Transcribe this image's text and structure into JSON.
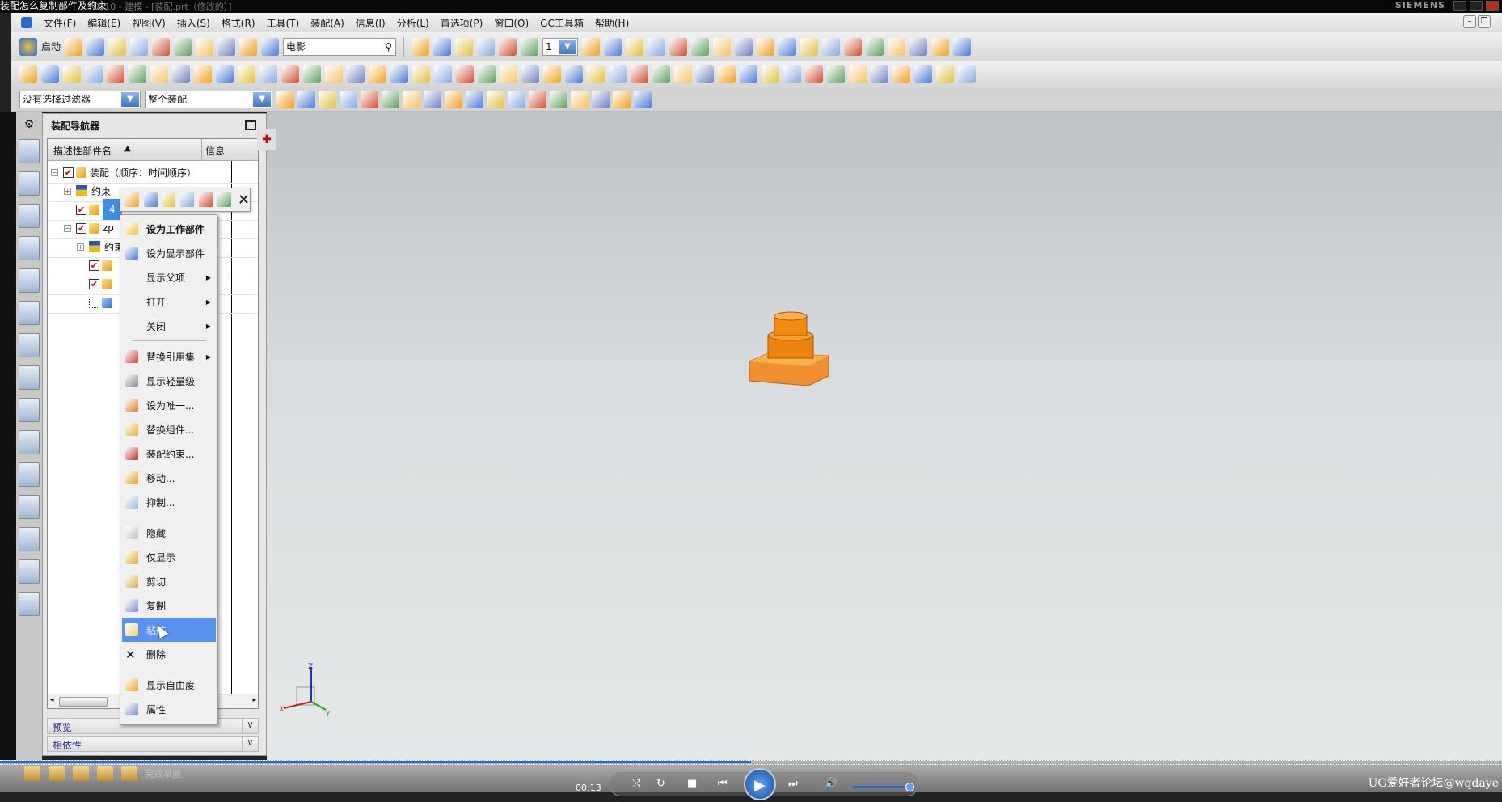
{
  "window": {
    "overlay_caption": "装配怎么复制部件及约束",
    "title": "NX 10 - 建模 - [装配.prt（修改的）]",
    "brand": "SIEMENS"
  },
  "menubar": [
    "文件(F)",
    "编辑(E)",
    "视图(V)",
    "插入(S)",
    "格式(R)",
    "工具(T)",
    "装配(A)",
    "信息(I)",
    "分析(L)",
    "首选项(P)",
    "窗口(O)",
    "GC工具箱",
    "帮助(H)"
  ],
  "toolbar": {
    "start_label": "启动",
    "search_value": "电影",
    "layer_value": "1",
    "selection_filter": "没有选择过滤器",
    "selection_scope": "整个装配",
    "row1_icons": [
      "new-icon",
      "open-icon",
      "save-icon",
      "cut-icon",
      "copy-icon",
      "paste-icon",
      "delete-icon",
      "undo-icon",
      "redo-icon",
      "repeat-command-icon"
    ],
    "row1b_icons": [
      "fit-icon",
      "zoom-icon",
      "render-style-icon",
      "orient-view-icon",
      "background-icon",
      "wcs-icon",
      "snap-view-icon",
      "layer-settings-icon",
      "move-to-layer-icon",
      "measure-icon",
      "analysis-icon",
      "curve-analysis-icon",
      "section-icon",
      "thickness-icon",
      "fastener-icon",
      "ring-icon",
      "hole-table-icon",
      "triangle-icon",
      "table-icon",
      "pmi-icon",
      "parts-list-icon",
      "note-icon",
      "gdt-icon",
      "fit-tolerance-icon"
    ],
    "row2_icons": [
      "sketch-icon",
      "datum-plane-icon",
      "extrude-icon",
      "revolve-icon",
      "split-body-icon",
      "block-icon",
      "cylinder-icon",
      "cone-icon",
      "sphere-icon",
      "boss-icon",
      "pocket-icon",
      "pad-icon",
      "groove-icon",
      "feature-array-icon",
      "emboss-icon",
      "pattern-icon",
      "mirror-icon",
      "unite-icon",
      "trim-body-icon",
      "draft-icon",
      "shell-icon",
      "offset-face-icon",
      "edge-blend-icon",
      "chamfer-icon",
      "face-blend-icon",
      "thread-icon",
      "point-set-icon",
      "wave-link-icon",
      "mesh-icon",
      "assembly-icon",
      "add-component-icon",
      "new-component-icon",
      "mate-icon",
      "check-icon",
      "bom-icon",
      "clearance-icon",
      "exploded-view-icon",
      "sequence-icon",
      "weld-icon",
      "fastener-assembly-icon",
      "component-array-icon",
      "move-component-icon",
      "replace-icon",
      "reference-set-icon"
    ],
    "row3_icons": [
      "selection-filter-settings-icon",
      "snap-point-icon",
      "select-icon",
      "deselect-icon",
      "box-select-icon",
      "select-body-icon",
      "select-face-icon",
      "existing-point-icon",
      "end-point-icon",
      "control-point-icon",
      "intersection-icon",
      "arc-center-icon",
      "tangent-icon",
      "quadrant-icon",
      "point-on-curve-icon",
      "point-on-face-icon",
      "bisector-icon",
      "list-icon"
    ]
  },
  "navigator": {
    "title": "装配导航器",
    "col_name": "描述性部件名",
    "col_info": "信息",
    "pin": "✚",
    "rows": [
      {
        "label": "装配（顺序：时间顺序）",
        "level": 0,
        "checked": true,
        "expand": "⊟",
        "icon": "assembly"
      },
      {
        "label": "约束",
        "level": 1,
        "checked": null,
        "expand": "⊞",
        "icon": "constraint"
      },
      {
        "label": "4",
        "level": 1,
        "checked": true,
        "expand": "",
        "icon": "part",
        "selected": true
      },
      {
        "label": "zp",
        "level": 1,
        "checked": true,
        "expand": "⊟",
        "icon": "assembly"
      },
      {
        "label": "约束",
        "level": 2,
        "checked": null,
        "expand": "⊞",
        "icon": "constraint",
        "info": "warning"
      },
      {
        "label": "",
        "level": 2,
        "checked": true,
        "expand": "",
        "icon": "part"
      },
      {
        "label": "",
        "level": 2,
        "checked": true,
        "expand": "",
        "icon": "part"
      },
      {
        "label": "",
        "level": 2,
        "checked": false,
        "expand": "",
        "icon": "body"
      }
    ],
    "panels": [
      "预览",
      "相依性"
    ]
  },
  "mini_toolbar": [
    "assembly-constraints-icon",
    "make-work-part-icon",
    "make-displayed-part-icon",
    "move-component-icon",
    "replace-component-icon",
    "show-dof-icon"
  ],
  "context_menu": [
    {
      "label": "设为工作部件",
      "icon": "make-work-part-icon",
      "bold": true,
      "color": "#f0c040"
    },
    {
      "label": "设为显示部件",
      "icon": "make-displayed-part-icon",
      "color": "#4a7ad8"
    },
    {
      "label": "显示父项",
      "sub": true
    },
    {
      "label": "打开",
      "sub": true
    },
    {
      "label": "关闭",
      "sub": true
    },
    {
      "sep": true
    },
    {
      "label": "替换引用集",
      "icon": "reference-set-icon",
      "sub": true,
      "color": "#d04040"
    },
    {
      "label": "显示轻量级",
      "icon": "lightweight-icon",
      "color": "#888888"
    },
    {
      "label": "设为唯一...",
      "icon": "make-unique-icon",
      "color": "#e08020"
    },
    {
      "label": "替换组件...",
      "icon": "replace-component-icon",
      "color": "#e0b030"
    },
    {
      "label": "装配约束...",
      "icon": "assembly-constraints-icon",
      "color": "#c03030"
    },
    {
      "label": "移动...",
      "icon": "move-icon",
      "color": "#e0a020"
    },
    {
      "label": "抑制...",
      "icon": "suppress-icon",
      "color": "#a0b8e0"
    },
    {
      "sep": true
    },
    {
      "label": "隐藏",
      "icon": "hide-icon",
      "color": "#c0c0c0"
    },
    {
      "label": "仅显示",
      "icon": "show-only-icon",
      "color": "#e0b030"
    },
    {
      "label": "剪切",
      "icon": "cut-icon",
      "color": "#d0b040"
    },
    {
      "label": "复制",
      "icon": "copy-icon",
      "color": "#8090d0"
    },
    {
      "label": "粘贴",
      "icon": "paste-icon",
      "highlight": true,
      "color": "#f0d070"
    },
    {
      "label": "删除",
      "icon": "delete-icon",
      "glyph": "✕"
    },
    {
      "sep": true
    },
    {
      "label": "显示自由度",
      "icon": "show-dof-icon",
      "color": "#f0a020"
    },
    {
      "label": "属性",
      "icon": "properties-icon",
      "color": "#8090d0"
    }
  ],
  "bottom": {
    "finish_sketch": "完成草图",
    "time": "00:13",
    "watermark": "UG爱好者论坛@wqdaye",
    "progress_percent": 50,
    "volume_percent": 90
  },
  "colors": {
    "accent": "#3d8ee8",
    "menu_highlight": "#5a93ef",
    "part": "#f08a10"
  }
}
